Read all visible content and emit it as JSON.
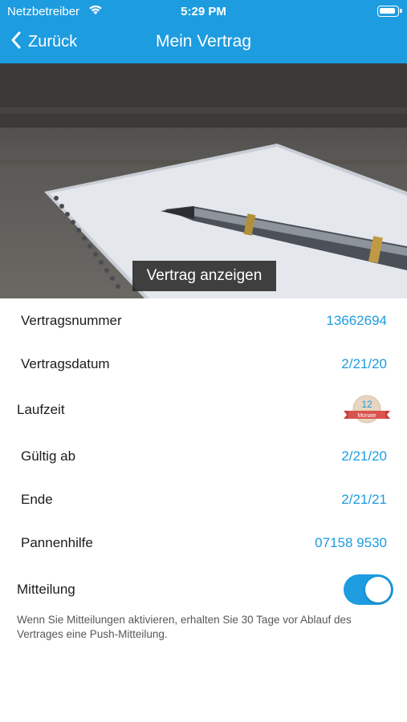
{
  "status": {
    "carrier": "Netzbetreiber",
    "time": "5:29 PM"
  },
  "nav": {
    "back_label": "Zurück",
    "title": "Mein Vertrag"
  },
  "hero": {
    "button_label": "Vertrag anzeigen"
  },
  "details": {
    "contract_number": {
      "label": "Vertragsnummer",
      "value": "13662694"
    },
    "contract_date": {
      "label": "Vertragsdatum",
      "value": "2/21/20"
    },
    "term": {
      "label": "Laufzeit",
      "badge_number": "12",
      "badge_unit": "Monate"
    },
    "valid_from": {
      "label": "Gültig ab",
      "value": "2/21/20"
    },
    "end": {
      "label": "Ende",
      "value": "2/21/21"
    },
    "breakdown_help": {
      "label": "Pannenhilfe",
      "value": "07158 9530"
    }
  },
  "notification": {
    "label": "Mitteilung",
    "enabled": true,
    "hint": "Wenn Sie Mitteilungen aktivieren, erhalten Sie 30 Tage vor Ablauf des Vertrages eine Push-Mitteilung."
  },
  "colors": {
    "accent": "#1d9ce0",
    "text": "#1c1c1e",
    "badge_ribbon": "#d9534f"
  }
}
